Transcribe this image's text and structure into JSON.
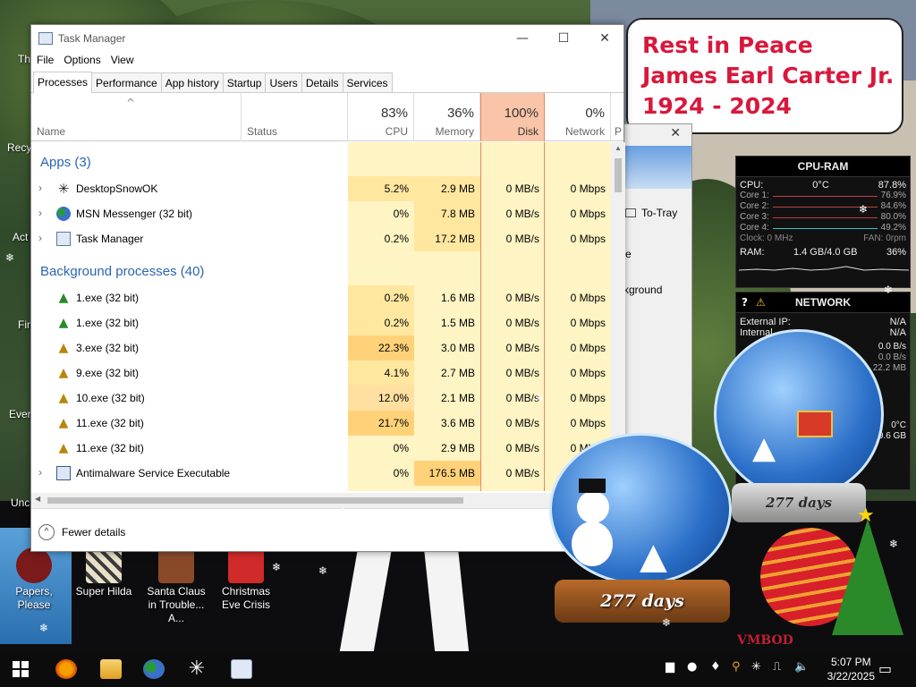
{
  "desktop": {
    "icons": [
      {
        "label": "Papers, Please",
        "color": "#7a1a1a"
      },
      {
        "label": "Super Hilda",
        "color": "#e8e0c8"
      },
      {
        "label": "Santa Claus in Trouble... A...",
        "color": "#8a4a2a"
      },
      {
        "label": "Christmas Eve Crisis",
        "color": "#d02a2a"
      }
    ],
    "edge_labels": [
      "Th",
      "Recy",
      "Act",
      "Fir",
      "Ever",
      "Unc"
    ],
    "rip": {
      "line1": "Rest in Peace",
      "line2": "James Earl Carter Jr.",
      "line3": "1924 - 2024"
    }
  },
  "gadget_cpu": {
    "title": "CPU-RAM",
    "cpu_label": "CPU:",
    "cpu_temp": "0°C",
    "cpu_pct": "87.8%",
    "cores": [
      {
        "label": "Core 1:",
        "value": "76.9%"
      },
      {
        "label": "Core 2:",
        "value": "84.6%"
      },
      {
        "label": "Core 3:",
        "value": "80.0%"
      },
      {
        "label": "Core 4:",
        "value": "49.2%"
      }
    ],
    "clock": "Clock: 0 MHz",
    "fan": "FAN: 0rpm",
    "ram_label": "RAM:",
    "ram_value": "1.4 GB/4.0 GB",
    "ram_pct": "36%"
  },
  "gadget_net": {
    "title": "NETWORK",
    "external_label": "External IP:",
    "external_value": "N/A",
    "internal_label": "Internal",
    "internal_value": "N/A",
    "rows": [
      "0.0 B/s",
      "0.0 B/s",
      "22.2 MB"
    ],
    "temp": "0°C",
    "disk": "9.6 GB"
  },
  "task_manager": {
    "title": "Task Manager",
    "menu": [
      "File",
      "Options",
      "View"
    ],
    "tabs": [
      "Processes",
      "Performance",
      "App history",
      "Startup",
      "Users",
      "Details",
      "Services"
    ],
    "columns": {
      "name": "Name",
      "status": "Status",
      "cpu_pct": "83%",
      "cpu": "CPU",
      "mem_pct": "36%",
      "mem": "Memory",
      "disk_pct": "100%",
      "disk": "Disk",
      "net_pct": "0%",
      "net": "Network",
      "p": "P"
    },
    "groups": {
      "apps": "Apps (3)",
      "bg": "Background processes (40)"
    },
    "apps": [
      {
        "name": "DesktopSnowOK",
        "cpu": "5.2%",
        "mem": "2.9 MB",
        "disk": "0 MB/s",
        "net": "0 Mbps"
      },
      {
        "name": "MSN Messenger (32 bit)",
        "cpu": "0%",
        "mem": "7.8 MB",
        "disk": "0 MB/s",
        "net": "0 Mbps"
      },
      {
        "name": "Task Manager",
        "cpu": "0.2%",
        "mem": "17.2 MB",
        "disk": "0 MB/s",
        "net": "0 Mbps"
      }
    ],
    "background": [
      {
        "name": "1.exe (32 bit)",
        "cpu": "0.2%",
        "mem": "1.6 MB",
        "disk": "0 MB/s",
        "net": "0 Mbps"
      },
      {
        "name": "1.exe (32 bit)",
        "cpu": "0.2%",
        "mem": "1.5 MB",
        "disk": "0 MB/s",
        "net": "0 Mbps"
      },
      {
        "name": "3.exe (32 bit)",
        "cpu": "22.3%",
        "mem": "3.0 MB",
        "disk": "0 MB/s",
        "net": "0 Mbps"
      },
      {
        "name": "9.exe (32 bit)",
        "cpu": "4.1%",
        "mem": "2.7 MB",
        "disk": "0 MB/s",
        "net": "0 Mbps"
      },
      {
        "name": "10.exe (32 bit)",
        "cpu": "12.0%",
        "mem": "2.1 MB",
        "disk": "0 MB/s",
        "net": "0 Mbps"
      },
      {
        "name": "11.exe (32 bit)",
        "cpu": "21.7%",
        "mem": "3.6 MB",
        "disk": "0 MB/s",
        "net": "0 Mbps"
      },
      {
        "name": "11.exe (32 bit)",
        "cpu": "0%",
        "mem": "2.9 MB",
        "disk": "0 MB/s",
        "net": "0 Mbps"
      },
      {
        "name": "Antimalware Service Executable",
        "cpu": "0%",
        "mem": "176.5 MB",
        "disk": "0 MB/s",
        "net": ""
      }
    ],
    "fewer_details": "Fewer details"
  },
  "back_window": {
    "to_tray": "To-Tray",
    "e": "e",
    "kground": "kground"
  },
  "globes": {
    "big_days": "277 days",
    "small_days": "277 days"
  },
  "watermark": "VMBOD",
  "taskbar": {
    "time": "5:07 PM",
    "date": "3/22/2025"
  },
  "colors": {
    "accent": "#2b65b0",
    "disk_header": "#f9c4a8",
    "heat_light": "#fff4c4",
    "heat_mid": "#ffe7a0",
    "heat_high": "#ffd27a"
  }
}
